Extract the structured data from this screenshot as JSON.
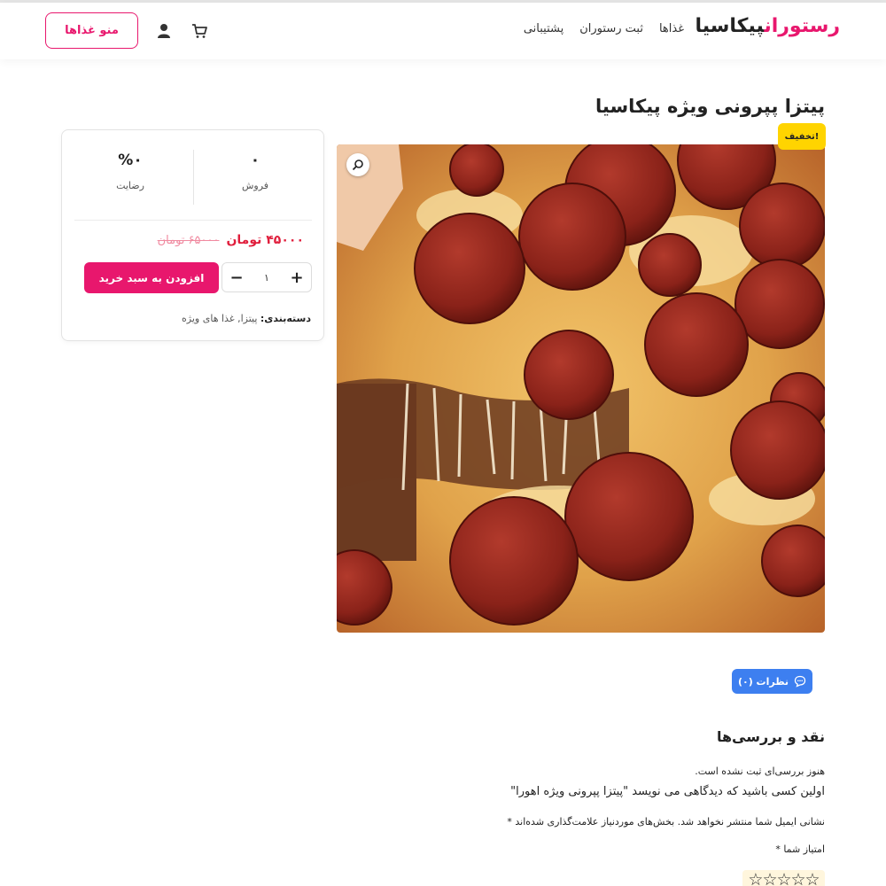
{
  "header": {
    "logo_part1": "رستوران",
    "logo_part2": "پیکاسیا",
    "nav": [
      "غذاها",
      "ثبت رستوران",
      "پشتیبانی"
    ],
    "menu_button": "منو غذاها"
  },
  "product": {
    "title": "پیتزا پپرونی ویژه پیکاسیا",
    "sale_badge": "تخفیف!",
    "stats": {
      "sales_value": "۰",
      "sales_label": "فروش",
      "satisfaction_value": "%۰",
      "satisfaction_label": "رضایت"
    },
    "price_new": "۴۵۰۰۰ تومان",
    "price_old": "۶۵۰۰۰ تومان",
    "quantity": "۱",
    "add_to_cart": "افزودن به سبد خرید",
    "category_label": "دسته‌بندی:",
    "category_value": "پیتزا, غذا های ویژه"
  },
  "tabs": {
    "reviews": "نظرات (۰)"
  },
  "reviews": {
    "title": "نقد و بررسی‌ها",
    "none": "هنوز بررسی‌ای ثبت نشده است.",
    "first": "اولین کسی باشید که دیدگاهی می نویسد \"پیتزا پپرونی ویژه اهورا\"",
    "notice": "نشانی ایمیل شما منتشر نخواهد شد. بخش‌های موردنیاز علامت‌گذاری شده‌اند *",
    "rating_label": "امتیاز شما *",
    "stars": "☆☆☆☆☆"
  },
  "colors": {
    "brand": "#e8176d",
    "price": "#e01e3c",
    "badge": "#ffd400",
    "tab": "#3d7ff0"
  },
  "icons": [
    "user-icon",
    "cart-icon",
    "zoom-icon",
    "chat-icon",
    "star-icon"
  ]
}
